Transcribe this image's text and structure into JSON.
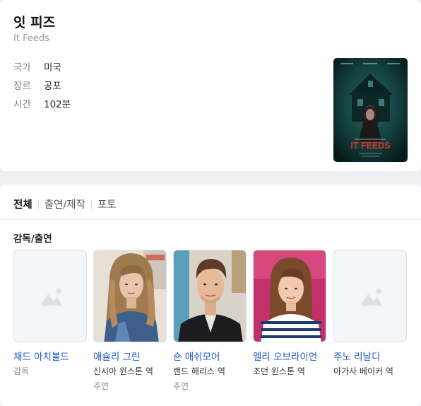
{
  "movie": {
    "title": "잇 피즈",
    "subtitle": "It Feeds",
    "info": [
      {
        "label": "국가",
        "value": "미국"
      },
      {
        "label": "장르",
        "value": "공포"
      },
      {
        "label": "시간",
        "value": "102분"
      }
    ],
    "poster_text": "IT FEEDS"
  },
  "tabs": [
    {
      "label": "전체",
      "active": true
    },
    {
      "label": "출연/제작",
      "active": false
    },
    {
      "label": "포토",
      "active": false
    }
  ],
  "section_title": "감독/출연",
  "people": [
    {
      "name": "채드 아치볼드",
      "role": "감독",
      "kind": "",
      "photo": "placeholder"
    },
    {
      "name": "애슐리 그린",
      "role": "신시아 윈스톤 역",
      "kind": "주연",
      "photo": "woman-long-hair"
    },
    {
      "name": "숀 애쉬모어",
      "role": "랜드 해리스 역",
      "kind": "주연",
      "photo": "man-short-hair"
    },
    {
      "name": "엘리 오브라이언",
      "role": "조던 윈스톤 역",
      "kind": "",
      "photo": "girl-brown-hair"
    },
    {
      "name": "주노 리날디",
      "role": "아가사 베이커 역",
      "kind": "",
      "photo": "placeholder"
    }
  ],
  "colors": {
    "link": "#1a55c9",
    "poster_title": "#d8322c",
    "poster_bg": "#0f3b3a"
  }
}
